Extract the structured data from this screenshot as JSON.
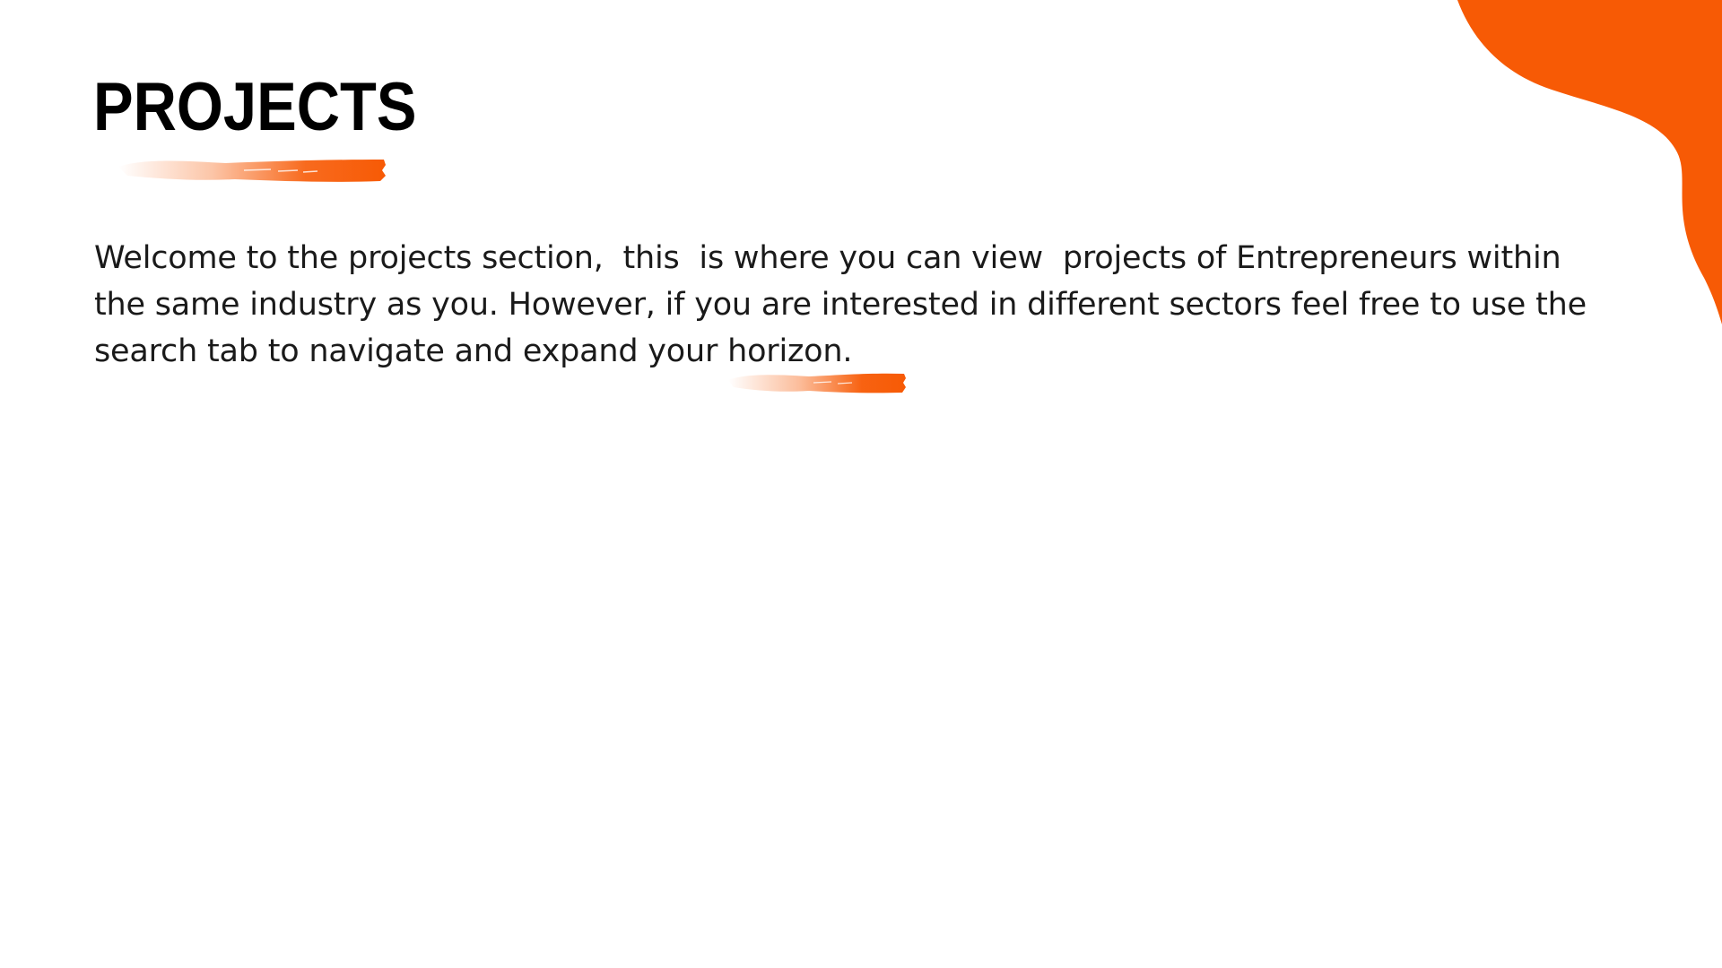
{
  "colors": {
    "accent": "#F75A05",
    "text": "#1a1a1a",
    "title": "#000000",
    "background": "#ffffff"
  },
  "page": {
    "title": "PROJECTS",
    "intro_text": "Welcome to the projects section,  this  is where you can view  projects of Entrepreneurs within the same industry as you. However, if you are interested in different sectors feel free to use the search tab to navigate and expand your horizon."
  },
  "decorations": {
    "corner_shape": "orange-blob",
    "title_underline": "orange-brush-stroke",
    "text_underline": "orange-brush-stroke"
  }
}
